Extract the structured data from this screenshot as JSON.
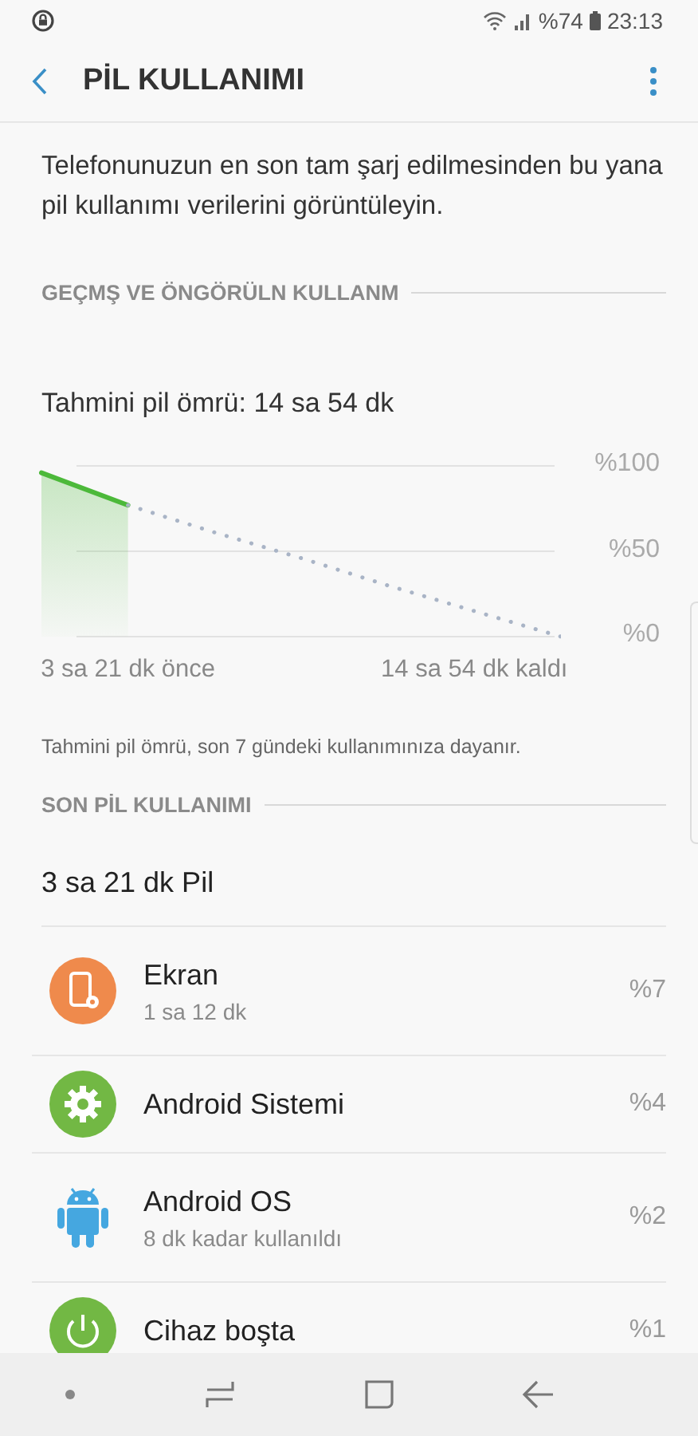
{
  "status_bar": {
    "battery": "%74",
    "time": "23:13"
  },
  "header": {
    "title": "PİL KULLANIMI"
  },
  "description": "Telefonunuzun en son tam şarj edilmesinden bu yana pil kullanımı verilerini görüntüleyin.",
  "history_section": {
    "title": "GEÇMŞ VE ÖNGÖRÜLN KULLANM",
    "estimate": "Tahmini pil ömrü: 14 sa 54 dk",
    "chart_data": {
      "type": "line",
      "categories": [
        null,
        "3 sa 21 dk önce",
        null,
        null,
        null,
        "14 sa 54 dk kaldı",
        null
      ],
      "series": [
        {
          "type": "area",
          "color": "#4cb93a",
          "line_style": "solid",
          "values": [
            96,
            77,
            null,
            null,
            null,
            null,
            null
          ]
        },
        {
          "type": "line",
          "color": "#a9b4c6",
          "line_style": "dotted",
          "values": [
            null,
            77,
            61,
            46,
            30,
            15,
            0
          ]
        }
      ],
      "ylim": [
        0,
        100
      ],
      "yticks": [
        {
          "value": 100,
          "label": "%100"
        },
        {
          "value": 50,
          "label": "%50"
        },
        {
          "value": 0,
          "label": "%0"
        }
      ]
    },
    "note": "Tahmini pil ömrü, son 7 gündeki kullanımınıza dayanır."
  },
  "usage_section": {
    "title": "SON PİL KULLANIMI",
    "total": "3 sa 21 dk Pil",
    "items": [
      {
        "kind": "screen",
        "name": "Ekran",
        "detail": "1 sa 12 dk",
        "percent": "%7"
      },
      {
        "kind": "system",
        "name": "Android Sistemi",
        "percent": "%4"
      },
      {
        "kind": "os",
        "name": "Android OS",
        "detail": "8 dk kadar kullanıldı",
        "percent": "%2"
      },
      {
        "kind": "idle",
        "name": "Cihaz boşta",
        "percent": "%1"
      }
    ]
  }
}
